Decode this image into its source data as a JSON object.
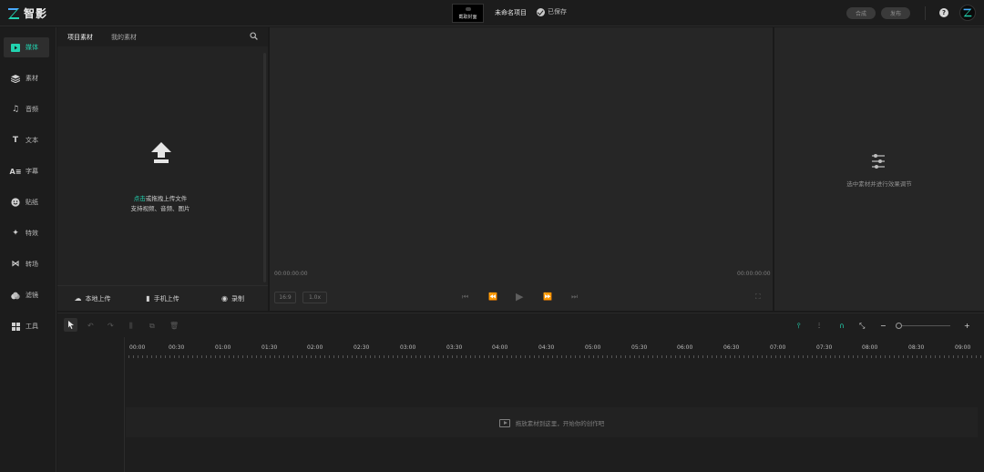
{
  "app": {
    "name": "智影",
    "cover_label": "截取封面",
    "project_name": "未命名项目",
    "save_status": "已保存",
    "compose_label": "合成",
    "publish_label": "发布",
    "help_symbol": "?",
    "accent": "#22d3b0"
  },
  "nav": {
    "items": [
      {
        "label": "媒体",
        "icon": "media-folder-icon",
        "active": true
      },
      {
        "label": "素材",
        "icon": "layers-icon"
      },
      {
        "label": "音频",
        "icon": "music-note-icon"
      },
      {
        "label": "文本",
        "icon": "text-t-icon"
      },
      {
        "label": "字幕",
        "icon": "subtitle-icon"
      },
      {
        "label": "贴纸",
        "icon": "sticker-face-icon"
      },
      {
        "label": "特效",
        "icon": "sparkle-icon"
      },
      {
        "label": "转场",
        "icon": "transition-icon"
      },
      {
        "label": "滤镜",
        "icon": "filter-icon"
      },
      {
        "label": "工具",
        "icon": "tools-grid-icon"
      }
    ]
  },
  "media": {
    "tabs": [
      "项目素材",
      "我的素材"
    ],
    "upload_highlight": "点击",
    "upload_rest": "或拖拽上传文件",
    "upload_types": "支持视频、音频、图片",
    "local_upload": "本地上传",
    "phone_upload": "手机上传",
    "record": "录制"
  },
  "preview": {
    "time_current": "00:00:00:00",
    "time_total": "00:00:00:00",
    "ratio": "16:9",
    "speed": "1.0x"
  },
  "inspector": {
    "hint": "选中素材并进行效果调节"
  },
  "timeline": {
    "ticks": [
      "00:00",
      "00:30",
      "01:00",
      "01:30",
      "02:00",
      "02:30",
      "03:00",
      "03:30",
      "04:00",
      "04:30",
      "05:00",
      "05:30",
      "06:00",
      "06:30",
      "07:00",
      "07:30",
      "08:00",
      "08:30",
      "09:00"
    ],
    "drop_hint": "拖放素材到这里，开始你的创作吧",
    "zoom_out": "−",
    "zoom_in": "+"
  }
}
